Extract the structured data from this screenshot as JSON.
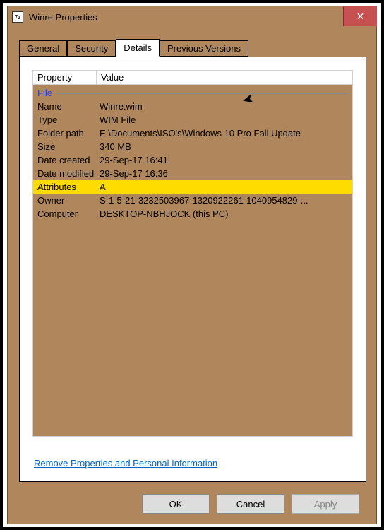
{
  "window": {
    "title": "Winre Properties"
  },
  "tabs": {
    "general": "General",
    "security": "Security",
    "details": "Details",
    "previous": "Previous Versions"
  },
  "grid_header": {
    "property": "Property",
    "value": "Value"
  },
  "section_file": "File",
  "properties": [
    {
      "prop": "Name",
      "val": "Winre.wim"
    },
    {
      "prop": "Type",
      "val": "WIM File"
    },
    {
      "prop": "Folder path",
      "val": "E:\\Documents\\ISO's\\Windows 10 Pro Fall Update"
    },
    {
      "prop": "Size",
      "val": "340 MB"
    },
    {
      "prop": "Date created",
      "val": "29-Sep-17 16:41"
    },
    {
      "prop": "Date modified",
      "val": "29-Sep-17 16:36"
    },
    {
      "prop": "Attributes",
      "val": "A"
    },
    {
      "prop": "Owner",
      "val": "S-1-5-21-3232503967-1320922261-1040954829-..."
    },
    {
      "prop": "Computer",
      "val": "DESKTOP-NBHJOCK (this PC)"
    }
  ],
  "selected_index": 6,
  "link_text": "Remove Properties and Personal Information",
  "buttons": {
    "ok": "OK",
    "cancel": "Cancel",
    "apply": "Apply"
  }
}
